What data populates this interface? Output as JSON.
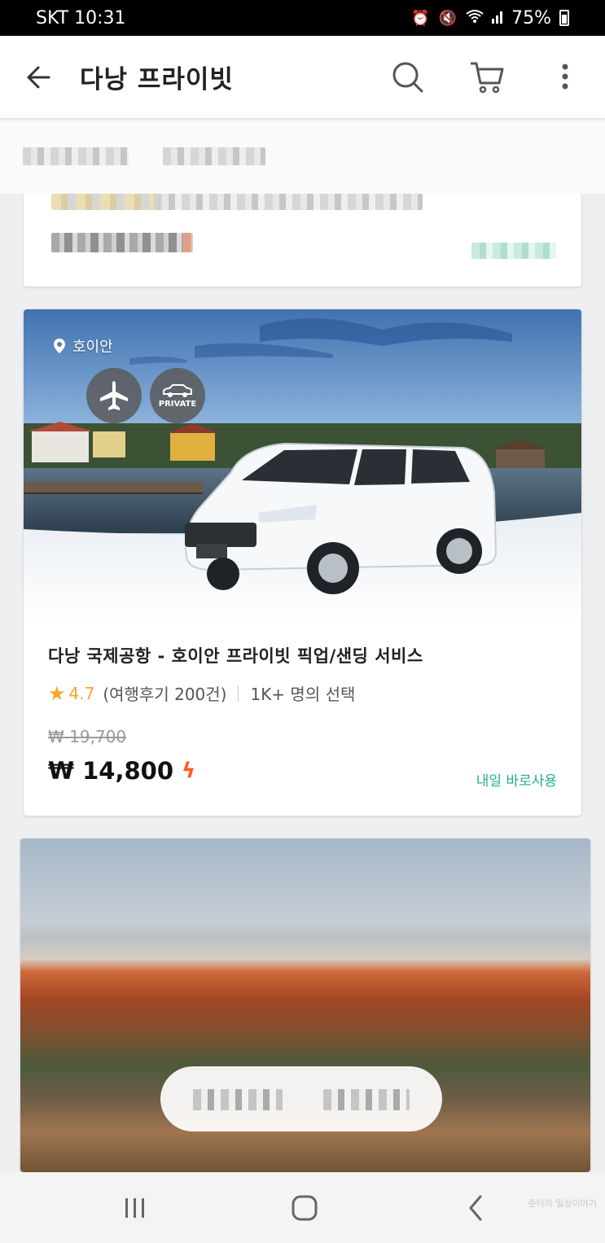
{
  "status_bar": {
    "carrier_time": "SKT 10:31",
    "battery": "75%",
    "icons": [
      "alarm-icon",
      "mute-icon",
      "wifi-icon",
      "signal-icon",
      "battery-icon"
    ]
  },
  "app_bar": {
    "title": "다낭 프라이빗",
    "icons": [
      "back-arrow-icon",
      "search-icon",
      "cart-icon",
      "more-icon"
    ]
  },
  "product": {
    "location": "호이안",
    "badge_private": "PRIVATE",
    "title": "다낭 국제공항 - 호이안 프라이빗 픽업/샌딩 서비스",
    "rating": "4.7",
    "reviews": "(여행후기 200건)",
    "bookings": "1K+ 명의 선택",
    "original_price": "₩ 19,700",
    "price": "₩ 14,800",
    "availability": "내일 바로사용"
  },
  "watermark": "준터의 일상이야기",
  "colors": {
    "accent_star": "#f5a623",
    "accent_bolt": "#ff5a1f",
    "availability_green": "#21b08b"
  }
}
